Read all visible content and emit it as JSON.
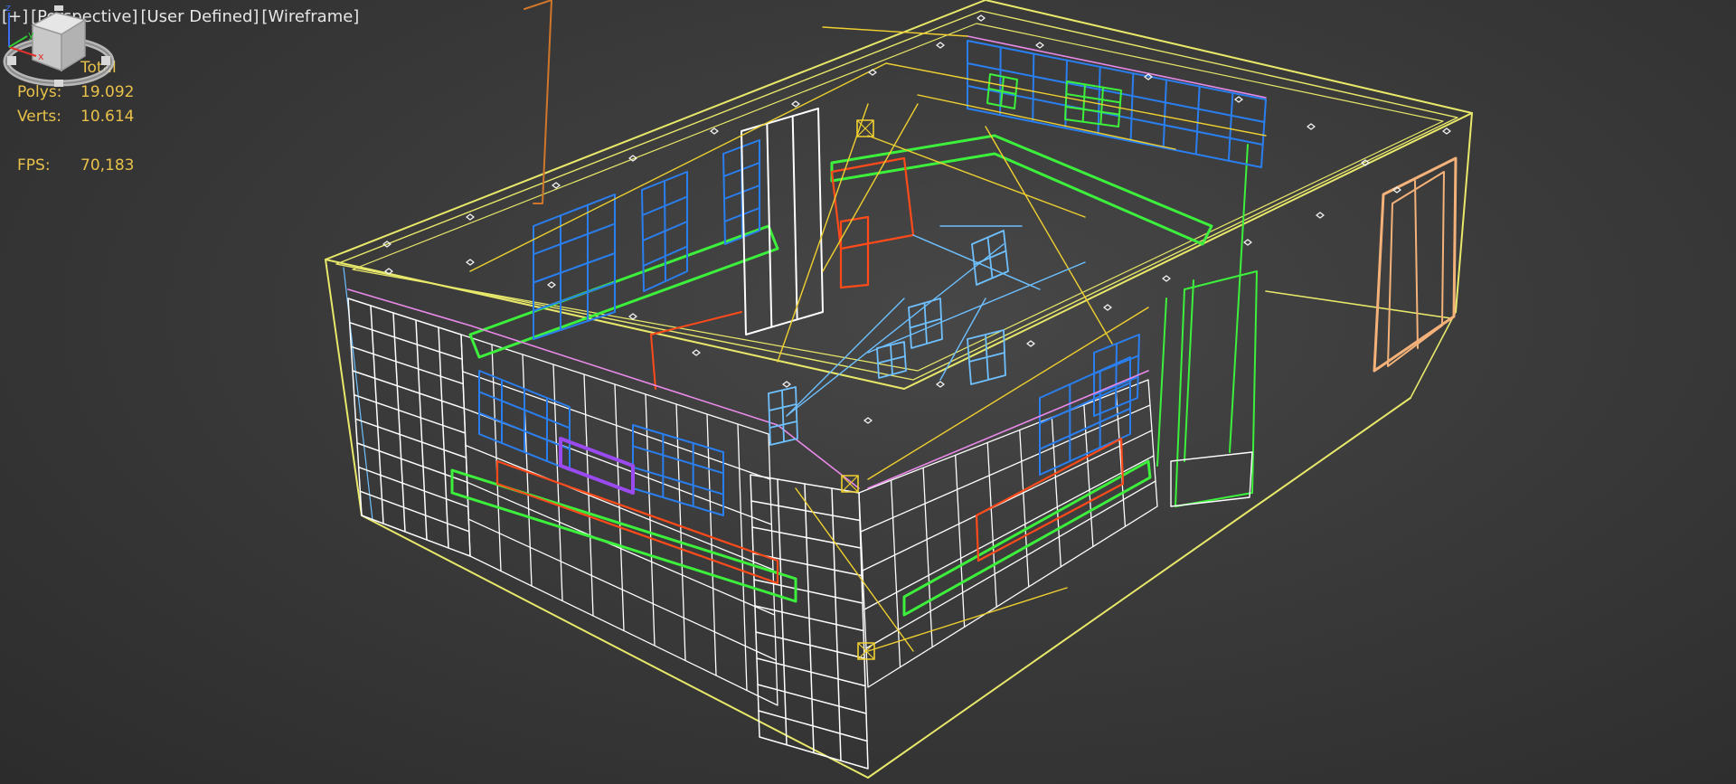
{
  "viewport": {
    "labels": {
      "plus": "[+]",
      "view": "[Perspective]",
      "shading_mode": "[User Defined]",
      "display": "[Wireframe]"
    },
    "stats": {
      "header": "Total",
      "polys_label": "Polys:",
      "polys_value": "19.092",
      "verts_label": "Verts:",
      "verts_value": "10.614",
      "fps_label": "FPS:",
      "fps_value": "70,183"
    },
    "axis": {
      "x": "x",
      "y": "y",
      "z": "z"
    },
    "colors": {
      "outline": "#e8e86a",
      "cabinet": "#ffffff",
      "green": "#3cf03c",
      "blue": "#2a7ff0",
      "red": "#ff4a1a",
      "pink": "#e889e8",
      "orange": "#f4b27a",
      "yellow": "#f0d030",
      "lightblue": "#6ec0ff"
    }
  }
}
